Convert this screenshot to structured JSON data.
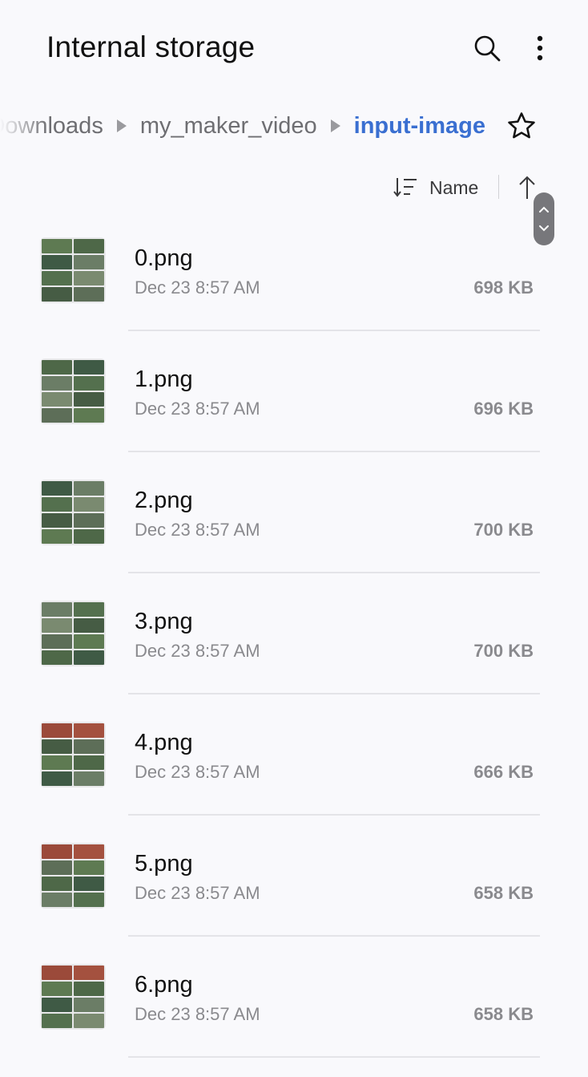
{
  "header": {
    "title": "Internal storage",
    "search_icon": "search-icon",
    "more_icon": "more-vert-icon"
  },
  "breadcrumb": {
    "items": [
      "Downloads",
      "my_maker_video",
      "input-image"
    ],
    "separator_icon": "triangle-right-icon",
    "favorite_icon": "star-outline-icon"
  },
  "sort": {
    "label": "Name",
    "sort_icon": "sort-icon",
    "direction_icon": "arrow-up-icon"
  },
  "colors": {
    "accent": "#3a6fd1",
    "background": "#f9f9fc",
    "secondary_text": "#8a8a8e"
  },
  "files": [
    {
      "name": "0.png",
      "date": "Dec 23 8:57 AM",
      "size": "698 KB"
    },
    {
      "name": "1.png",
      "date": "Dec 23 8:57 AM",
      "size": "696 KB"
    },
    {
      "name": "2.png",
      "date": "Dec 23 8:57 AM",
      "size": "700 KB"
    },
    {
      "name": "3.png",
      "date": "Dec 23 8:57 AM",
      "size": "700 KB"
    },
    {
      "name": "4.png",
      "date": "Dec 23 8:57 AM",
      "size": "666 KB"
    },
    {
      "name": "5.png",
      "date": "Dec 23 8:57 AM",
      "size": "658 KB"
    },
    {
      "name": "6.png",
      "date": "Dec 23 8:57 AM",
      "size": "658 KB"
    }
  ]
}
